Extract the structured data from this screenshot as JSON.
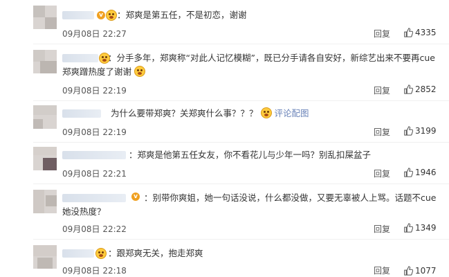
{
  "comments": [
    {
      "text": "：郑爽是第五任，不是初恋，谢谢",
      "time": "09月08日 22:27",
      "reply": "回复",
      "likes": "4335"
    },
    {
      "text_a": "：分手多年，郑爽称“对此人记忆模糊”，既已分手请各自安好，新综艺出来不要再cue郑爽蹭热度了谢谢",
      "time": "09月08日 22:19",
      "reply": "回复",
      "likes": "2852"
    },
    {
      "text": "为什么要带郑爽？关郑爽什么事？？？",
      "link": "评论配图",
      "time": "09月08日 22:19",
      "reply": "回复",
      "likes": "3199"
    },
    {
      "text": "：郑爽是他第五任女友，你不看花儿与少年一吗？别乱扣屎盆子",
      "time": "09月08日 22:21",
      "reply": "回复",
      "likes": "1946"
    },
    {
      "text": "：别带你爽姐，她一句话没说，什么都没做，又要无辜被人上骂。话题不cue她没热度？",
      "time": "09月08日 22:22",
      "reply": "回复",
      "likes": "1349"
    },
    {
      "text": "：跟郑爽无关，抱走郑爽",
      "time": "09月08日 22:18",
      "reply": "回复",
      "likes": "1077"
    }
  ],
  "icons": {
    "like": "thumbs-up-icon",
    "verified": "verified-v-icon",
    "emoji": "emoji-icon"
  },
  "colors": {
    "link": "#6b84b9",
    "verified": "#f0a020",
    "text": "#333333",
    "meta": "#555555"
  }
}
